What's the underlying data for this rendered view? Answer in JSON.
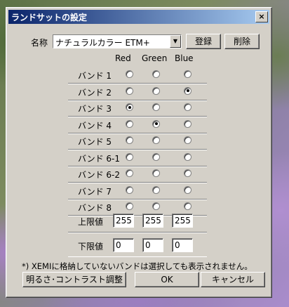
{
  "window": {
    "title": "ランドサットの設定",
    "close_label": "×"
  },
  "preset": {
    "label": "名称",
    "selected": "ナチュラルカラー ETM+",
    "register_button": "登録",
    "delete_button": "削除"
  },
  "columns": [
    "Red",
    "Green",
    "Blue"
  ],
  "bands": [
    {
      "label": "バンド 1",
      "selected": null
    },
    {
      "label": "バンド 2",
      "selected": "Blue"
    },
    {
      "label": "バンド 3",
      "selected": "Red"
    },
    {
      "label": "バンド 4",
      "selected": "Green"
    },
    {
      "label": "バンド 5",
      "selected": null
    },
    {
      "label": "バンド 6-1",
      "selected": null
    },
    {
      "label": "バンド 6-2",
      "selected": null
    },
    {
      "label": "バンド 7",
      "selected": null
    },
    {
      "label": "バンド 8",
      "selected": null
    }
  ],
  "upper_limit": {
    "label": "上限値",
    "red": "255",
    "green": "255",
    "blue": "255"
  },
  "lower_limit": {
    "label": "下限値",
    "red": "0",
    "green": "0",
    "blue": "0"
  },
  "note": "*) XEMIに格納していないバンドは選択しても表示されません。",
  "buttons": {
    "brightness": "明るさ･コントラスト調整",
    "ok": "OK",
    "cancel": "キャンセル"
  }
}
